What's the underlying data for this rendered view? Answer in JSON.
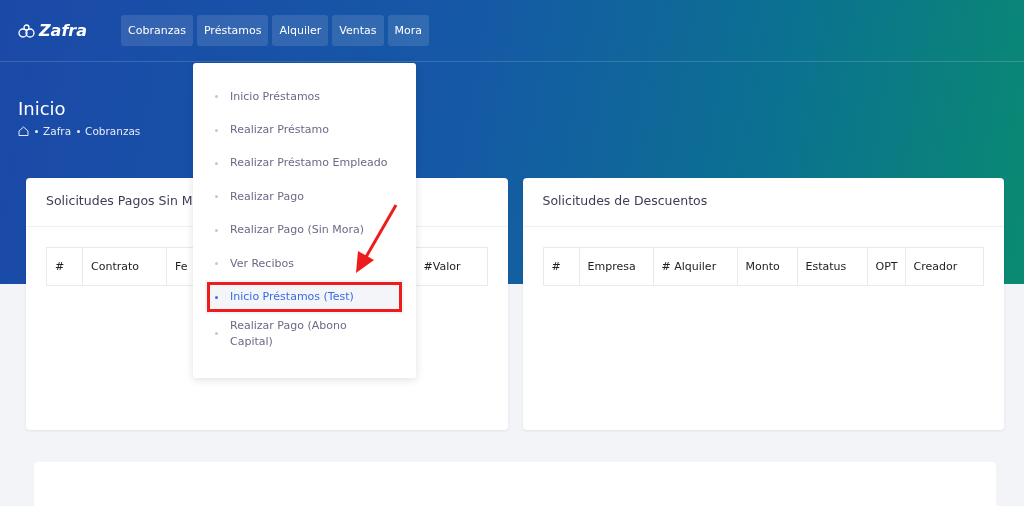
{
  "brand": {
    "name": "Zafra"
  },
  "nav": [
    {
      "label": "Cobranzas"
    },
    {
      "label": "Préstamos"
    },
    {
      "label": "Alquiler"
    },
    {
      "label": "Ventas"
    },
    {
      "label": "Mora"
    }
  ],
  "page": {
    "title": "Inicio",
    "breadcrumb": [
      "Zafra",
      "Cobranzas"
    ]
  },
  "cards": [
    {
      "title": "Solicitudes Pagos Sin M",
      "columns": [
        "#",
        "Contrato",
        "Fe",
        "#Valor"
      ]
    },
    {
      "title": "Solicitudes de Descuentos",
      "columns": [
        "#",
        "Empresa",
        "# Alquiler",
        "Monto",
        "Estatus",
        "OPT",
        "Creador"
      ]
    }
  ],
  "dropdown": {
    "items": [
      {
        "label": "Inicio Préstamos",
        "selected": false,
        "annotated": false
      },
      {
        "label": "Realizar Préstamo",
        "selected": false,
        "annotated": false
      },
      {
        "label": "Realizar Préstamo Empleado",
        "selected": false,
        "annotated": false
      },
      {
        "label": "Realizar Pago",
        "selected": false,
        "annotated": false
      },
      {
        "label": "Realizar Pago (Sin Mora)",
        "selected": false,
        "annotated": false
      },
      {
        "label": "Ver Recibos",
        "selected": false,
        "annotated": false
      },
      {
        "label": "Inicio Préstamos (Test)",
        "selected": true,
        "annotated": true
      },
      {
        "label": "Realizar Pago (Abono Capital)",
        "selected": false,
        "annotated": false
      }
    ]
  }
}
